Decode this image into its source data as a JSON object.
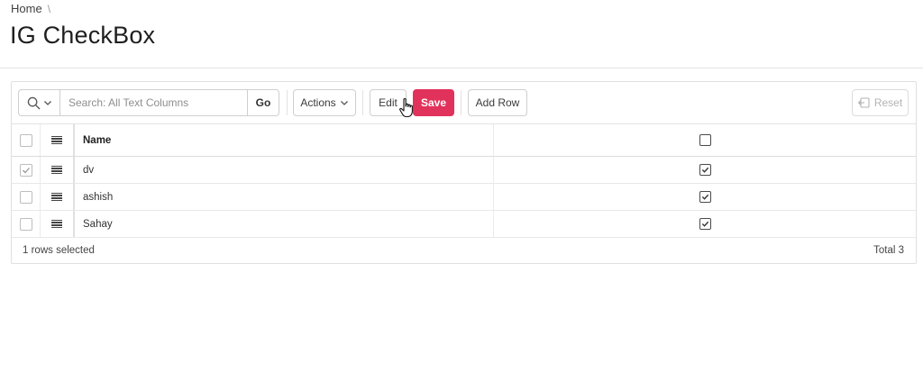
{
  "breadcrumb": {
    "home": "Home",
    "separator": "\\"
  },
  "page": {
    "title": "IG CheckBox"
  },
  "toolbar": {
    "search_menu_icon": "search-icon",
    "search_placeholder": "Search: All Text Columns",
    "go_label": "Go",
    "actions_label": "Actions",
    "edit_label": "Edit",
    "save_label": "Save",
    "add_row_label": "Add Row",
    "reset_label": "Reset"
  },
  "grid": {
    "columns": {
      "name": "Name",
      "flag": ""
    },
    "rows": [
      {
        "selected": true,
        "name": "dv",
        "flag": true
      },
      {
        "selected": false,
        "name": "ashish",
        "flag": true
      },
      {
        "selected": false,
        "name": "Sahay",
        "flag": true
      }
    ]
  },
  "footer": {
    "selection": "1 rows selected",
    "total": "Total 3"
  },
  "colors": {
    "save": "#e1325c",
    "border": "#cfcfcf",
    "text": "#262626"
  }
}
